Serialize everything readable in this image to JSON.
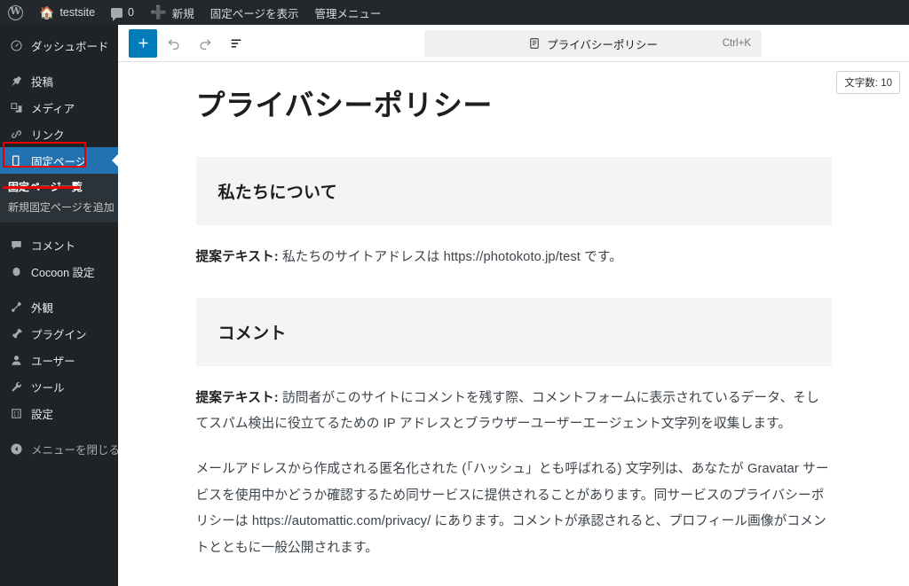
{
  "adminbar": {
    "wp_logo": "wordpress-logo-icon",
    "site_name": "testsite",
    "comment_count": "0",
    "new_label": "新規",
    "view_page_label": "固定ページを表示",
    "admin_menu_label": "管理メニュー"
  },
  "sidebar": {
    "items": [
      {
        "label": "ダッシュボード",
        "icon": "dashboard-icon",
        "state": "normal"
      },
      {
        "label": "投稿",
        "icon": "pin-icon",
        "state": "normal"
      },
      {
        "label": "メディア",
        "icon": "media-icon",
        "state": "normal"
      },
      {
        "label": "リンク",
        "icon": "link-icon",
        "state": "normal"
      },
      {
        "label": "固定ページ",
        "icon": "page-icon",
        "state": "current"
      },
      {
        "label": "コメント",
        "icon": "comment-icon",
        "state": "normal"
      },
      {
        "label": "Cocoon 設定",
        "icon": "cocoon-icon",
        "state": "normal"
      },
      {
        "label": "外観",
        "icon": "appearance-icon",
        "state": "normal"
      },
      {
        "label": "プラグイン",
        "icon": "plugin-icon",
        "state": "normal"
      },
      {
        "label": "ユーザー",
        "icon": "user-icon",
        "state": "normal"
      },
      {
        "label": "ツール",
        "icon": "tools-icon",
        "state": "normal"
      },
      {
        "label": "設定",
        "icon": "settings-icon",
        "state": "normal"
      },
      {
        "label": "メニューを閉じる",
        "icon": "collapse-icon",
        "state": "dim"
      }
    ],
    "submenu": [
      {
        "label": "固定ページ一覧",
        "active": true
      },
      {
        "label": "新規固定ページを追加",
        "active": false
      }
    ]
  },
  "toolbar": {
    "add_block_label": "+",
    "undo_icon": "undo-icon",
    "redo_icon": "redo-icon",
    "list_view_icon": "list-view-icon"
  },
  "command_bar": {
    "doc_icon": "document-icon",
    "title": "プライバシーポリシー",
    "shortcut": "Ctrl+K"
  },
  "word_count": {
    "label": "文字数: 10"
  },
  "post": {
    "title": "プライバシーポリシー",
    "blocks": [
      {
        "type": "heading",
        "text": "私たちについて"
      },
      {
        "type": "paragraph",
        "lead": "提案テキスト:",
        "text": " 私たちのサイトアドレスは https://photokoto.jp/test です。"
      },
      {
        "type": "heading",
        "text": "コメント"
      },
      {
        "type": "paragraph",
        "lead": "提案テキスト:",
        "text": " 訪問者がこのサイトにコメントを残す際、コメントフォームに表示されているデータ、そしてスパム検出に役立てるための IP アドレスとブラウザーユーザーエージェント文字列を収集します。"
      },
      {
        "type": "paragraph",
        "lead": "",
        "text": "メールアドレスから作成される匿名化された (「ハッシュ」とも呼ばれる) 文字列は、あなたが Gravatar サービスを使用中かどうか確認するため同サービスに提供されることがあります。同サービスのプライバシーポリシーは https://automattic.com/privacy/ にあります。コメントが承認されると、プロフィール画像がコメントとともに一般公開されます。"
      }
    ]
  },
  "annotations": {
    "highlight_color": "#e60000",
    "boxed_item": "固定ページ",
    "underlined_item": "固定ページ一覧"
  },
  "colors": {
    "adminbar_bg": "#23282d",
    "sidebar_bg": "#1d2327",
    "submenu_bg": "#2c3338",
    "active_blue": "#2271b1",
    "button_blue": "#007cba",
    "block_bg": "#f3f4f6",
    "annotation_red": "#e60000"
  }
}
